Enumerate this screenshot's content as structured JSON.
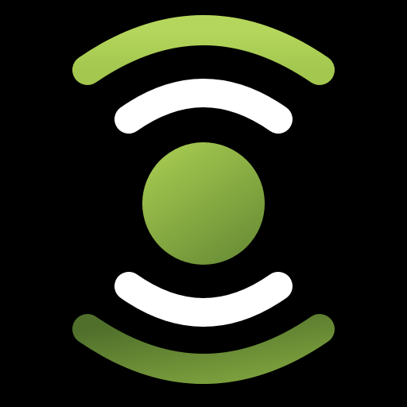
{
  "icon": {
    "name": "broadcast-signal-icon",
    "colors": {
      "background": "#000000",
      "green_light": "#b2d35a",
      "green_mid": "#84a940",
      "green_dark": "#52732c",
      "white": "#ffffff"
    }
  }
}
